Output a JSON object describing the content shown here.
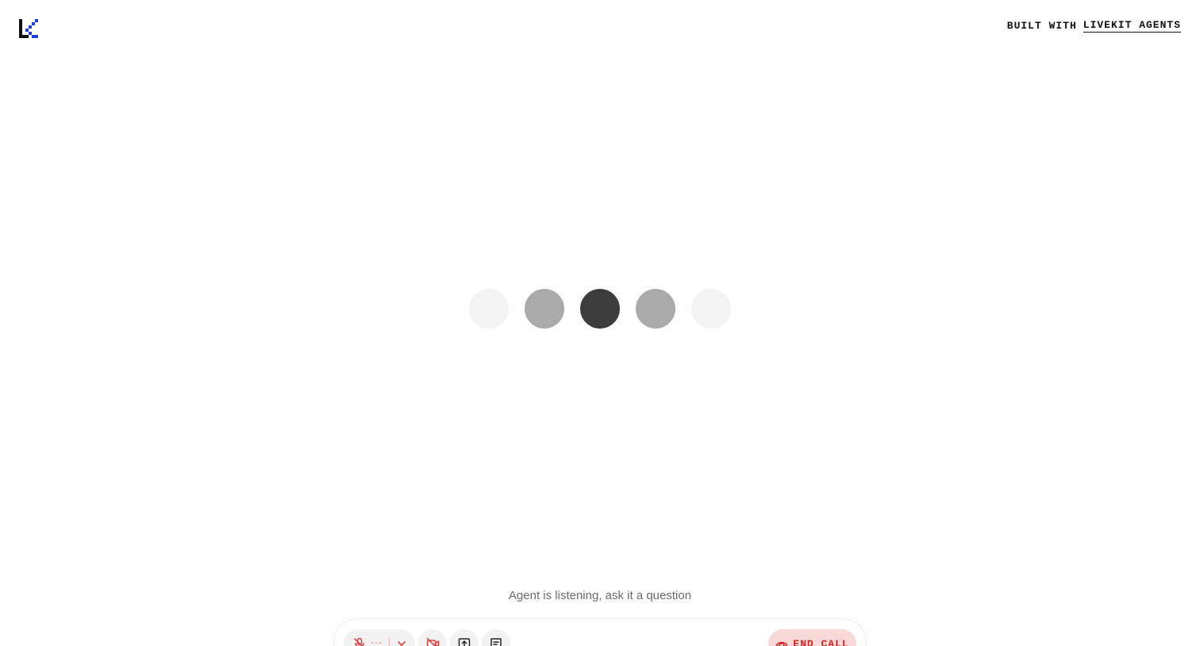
{
  "header": {
    "built_with_prefix": "BUILT WITH",
    "built_with_link": "LIVEKIT AGENTS"
  },
  "visualizer": {
    "bars": [
      {
        "color": "#f3f3f3"
      },
      {
        "color": "#aaaaaa"
      },
      {
        "color": "#3c3c3c"
      },
      {
        "color": "#aaaaaa"
      },
      {
        "color": "#f3f3f3"
      }
    ]
  },
  "status": {
    "text": "Agent is listening, ask it a question"
  },
  "controls": {
    "mic_level": "···",
    "end_call_label": "END CALL"
  },
  "colors": {
    "accent_blue": "#1f3fe0",
    "danger": "#e03b3b"
  }
}
